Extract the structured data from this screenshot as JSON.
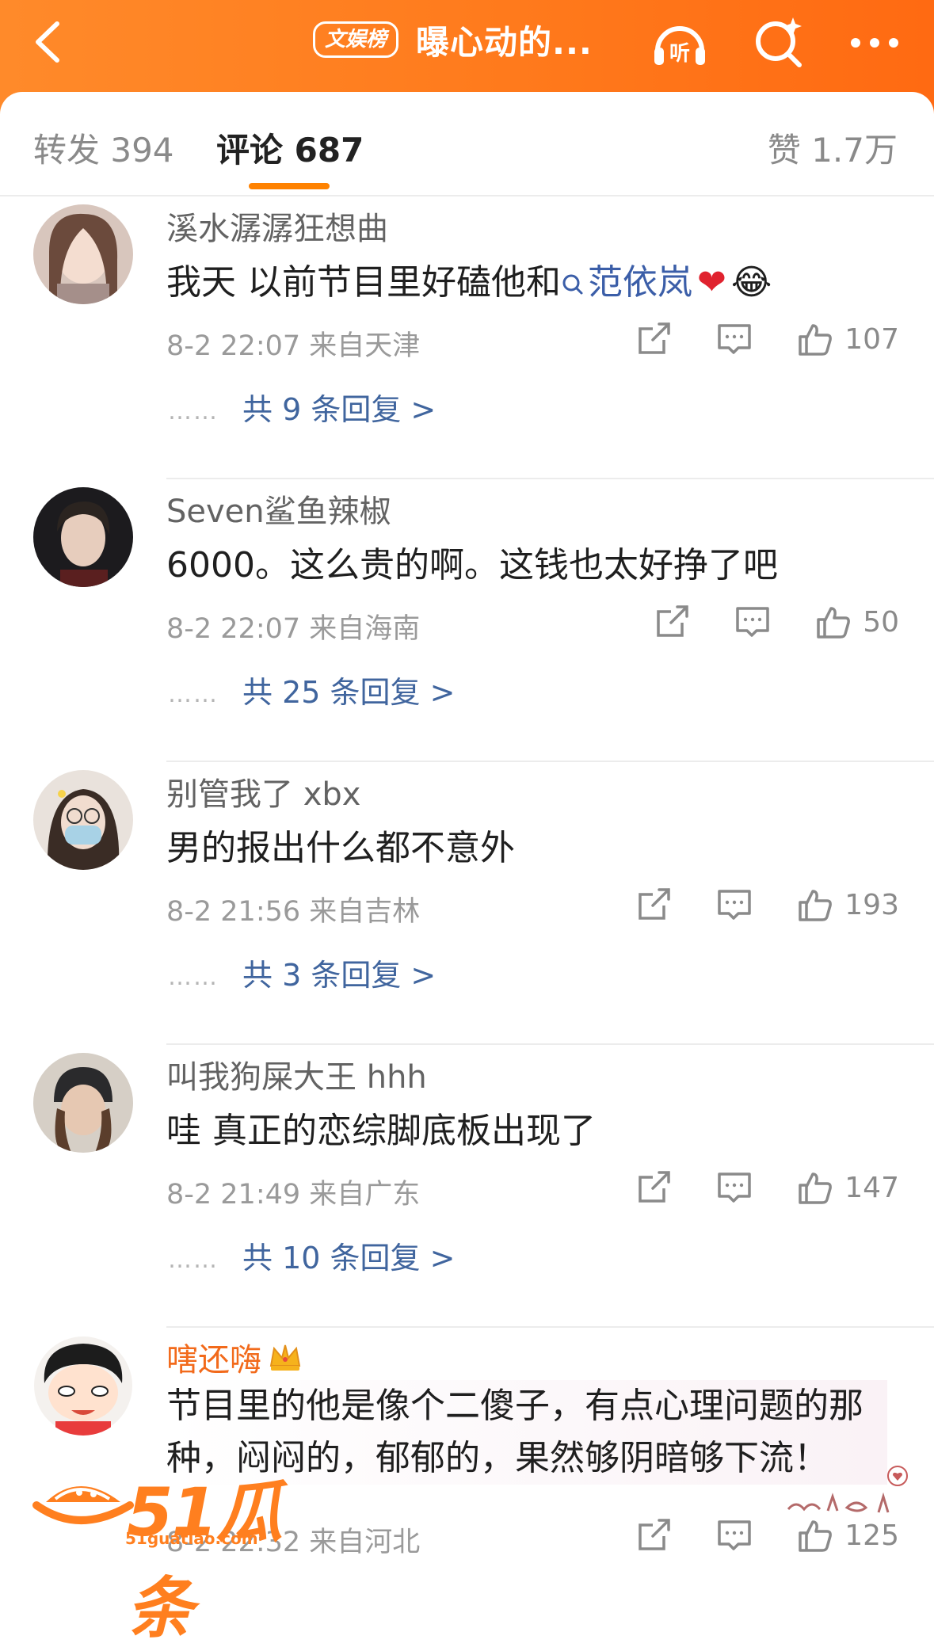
{
  "header": {
    "badge": "文娱榜",
    "title": "曝心动的...",
    "listen_label": "听"
  },
  "tabs": {
    "repost": "转发 394",
    "comment": "评论 687",
    "like": "赞 1.7万"
  },
  "comments": [
    {
      "username": "溪水潺潺狂想曲",
      "text_before": "我天  以前节目里好磕他和",
      "topic": "范依岚",
      "emoji": "❤",
      "emoji2": "😂",
      "meta": "8-2 22:07  来自天津",
      "likes": "107",
      "replies": "共 9 条回复 >"
    },
    {
      "username": "Seven鲨鱼辣椒",
      "text": "6000。这么贵的啊。这钱也太好挣了吧",
      "meta": "8-2 22:07  来自海南",
      "likes": "50",
      "replies": "共 25 条回复 >"
    },
    {
      "username": "别管我了 xbx",
      "text": "男的报出什么都不意外",
      "meta": "8-2 21:56  来自吉林",
      "likes": "193",
      "replies": "共 3 条回复 >"
    },
    {
      "username": "叫我狗屎大王 hhh",
      "text": "哇 真正的恋综脚底板出现了",
      "meta": "8-2 21:49  来自广东",
      "likes": "147",
      "replies": "共 10 条回复 >"
    },
    {
      "username": "嗐还嗨",
      "text_line1": "节目里的他是像个二傻子，有点心理问题的那",
      "text_line2": "种，闷闷的，郁郁的，果然够阴暗够下流！",
      "meta": "8-2 22:32  来自河北",
      "likes": "125"
    }
  ],
  "reply_dots": "……",
  "watermark": {
    "brand": "51瓜条",
    "url": "51guatiao.com"
  },
  "colors": {
    "header_orange": "#ff7a1c",
    "tab_underline": "#ff8200",
    "link_blue": "#40659e",
    "vip_name": "#f26a1b"
  },
  "icons": [
    "back-arrow-icon",
    "listen-icon",
    "search-icon",
    "more-icon",
    "share-icon",
    "comment-icon",
    "like-icon",
    "search-mini-icon",
    "heart-icon",
    "crown-icon"
  ]
}
